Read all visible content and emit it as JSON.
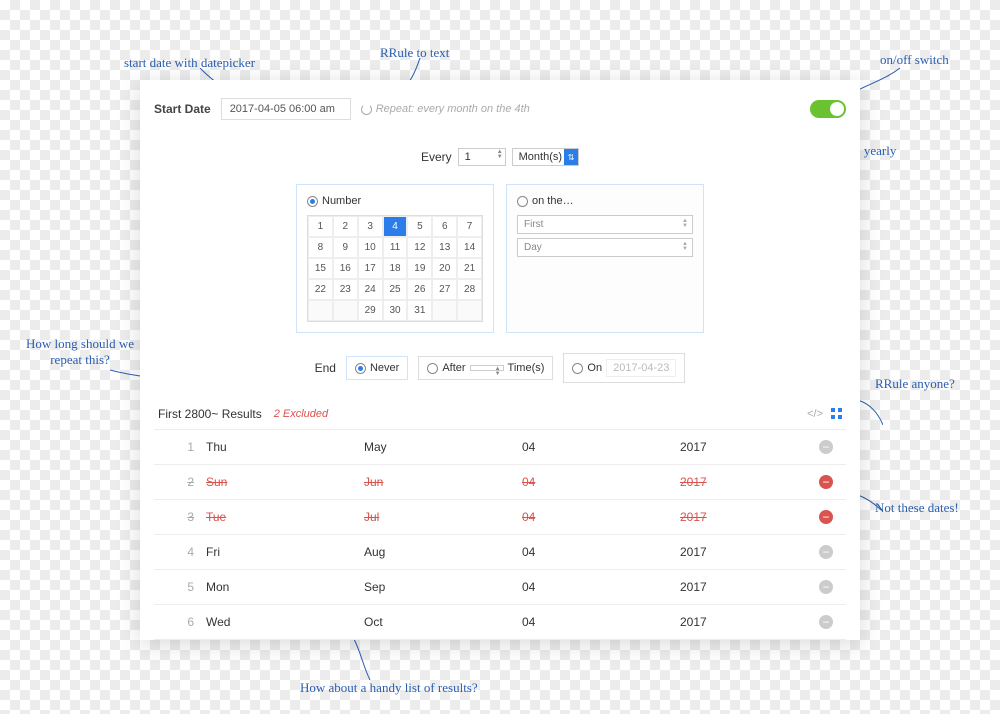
{
  "annotations": {
    "a1": "start date with datepicker",
    "a2": "RRule to text",
    "a3": "on/off switch",
    "a4": "daily, weekly, monthly, yearly",
    "a5": "How long should we repeat this?",
    "a6": "RRule anyone?",
    "a7": "Not these dates!",
    "a8": "How about a handy list of results?"
  },
  "header": {
    "start_label": "Start Date",
    "start_value": "2017-04-05 06:00 am",
    "rrule_text": "Repeat: every month on the 4th"
  },
  "every": {
    "label": "Every",
    "count": "1",
    "unit": "Month(s)"
  },
  "panel_number": {
    "title": "Number",
    "selected_day": 4,
    "grid": [
      [
        1,
        2,
        3,
        4,
        5,
        6,
        7
      ],
      [
        8,
        9,
        10,
        11,
        12,
        13,
        14
      ],
      [
        15,
        16,
        17,
        18,
        19,
        20,
        21
      ],
      [
        22,
        23,
        24,
        25,
        26,
        27,
        28
      ],
      [
        null,
        null,
        29,
        30,
        31,
        null,
        null
      ]
    ]
  },
  "panel_onthe": {
    "title": "on the…",
    "ordinal": "First",
    "weekday": "Day"
  },
  "end": {
    "label": "End",
    "never": "Never",
    "after": "After",
    "times": "Time(s)",
    "after_count": "",
    "on": "On",
    "on_date": "2017-04-23"
  },
  "results": {
    "heading": "First 2800~ Results",
    "excluded_label": "2 Excluded",
    "rows": [
      {
        "n": "1",
        "dow": "Thu",
        "mon": "May",
        "day": "04",
        "yr": "2017",
        "excl": false
      },
      {
        "n": "2",
        "dow": "Sun",
        "mon": "Jun",
        "day": "04",
        "yr": "2017",
        "excl": true
      },
      {
        "n": "3",
        "dow": "Tue",
        "mon": "Jul",
        "day": "04",
        "yr": "2017",
        "excl": true
      },
      {
        "n": "4",
        "dow": "Fri",
        "mon": "Aug",
        "day": "04",
        "yr": "2017",
        "excl": false
      },
      {
        "n": "5",
        "dow": "Mon",
        "mon": "Sep",
        "day": "04",
        "yr": "2017",
        "excl": false
      },
      {
        "n": "6",
        "dow": "Wed",
        "mon": "Oct",
        "day": "04",
        "yr": "2017",
        "excl": false
      }
    ]
  }
}
